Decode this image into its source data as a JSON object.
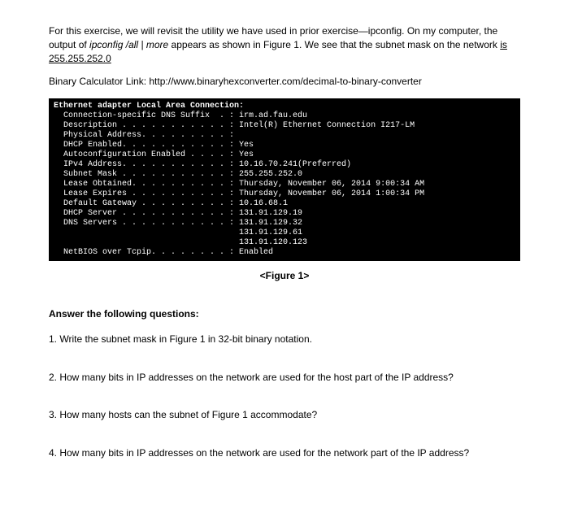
{
  "intro": {
    "part1": "For this exercise, we will revisit the utility we have used in prior exercise—ipconfig. On my computer, the output of ",
    "cmd": "ipconfig /all | more",
    "part2": " appears as shown in Figure 1. We see that the subnet mask on the network ",
    "underline": "is  255.255.252.0"
  },
  "calc_link": "Binary Calculator Link: http://www.binaryhexconverter.com/decimal-to-binary-converter",
  "terminal": {
    "header": "Ethernet adapter Local Area Connection:",
    "body": "  Connection-specific DNS Suffix  . : irm.ad.fau.edu\n  Description . . . . . . . . . . . : Intel(R) Ethernet Connection I217-LM\n  Physical Address. . . . . . . . . :\n  DHCP Enabled. . . . . . . . . . . : Yes\n  Autoconfiguration Enabled . . . . : Yes\n  IPv4 Address. . . . . . . . . . . : 10.16.70.241(Preferred)\n  Subnet Mask . . . . . . . . . . . : 255.255.252.0\n  Lease Obtained. . . . . . . . . . : Thursday, November 06, 2014 9:00:34 AM\n  Lease Expires . . . . . . . . . . : Thursday, November 06, 2014 1:00:34 PM\n  Default Gateway . . . . . . . . . : 10.16.68.1\n  DHCP Server . . . . . . . . . . . : 131.91.129.19\n  DNS Servers . . . . . . . . . . . : 131.91.129.32\n                                      131.91.129.61\n                                      131.91.120.123\n  NetBIOS over Tcpip. . . . . . . . : Enabled"
  },
  "figure_label": "<Figure 1>",
  "questions_header": "Answer the following questions:",
  "questions": {
    "q1": "1. Write the subnet mask in Figure 1 in 32-bit binary notation.",
    "q2": "2. How many bits in IP addresses on the network are used for the host part of the IP address?",
    "q3": "3. How many hosts can the subnet of Figure 1 accommodate?",
    "q4": "4. How many bits in IP addresses on the network are used for the network part of the IP address?"
  }
}
